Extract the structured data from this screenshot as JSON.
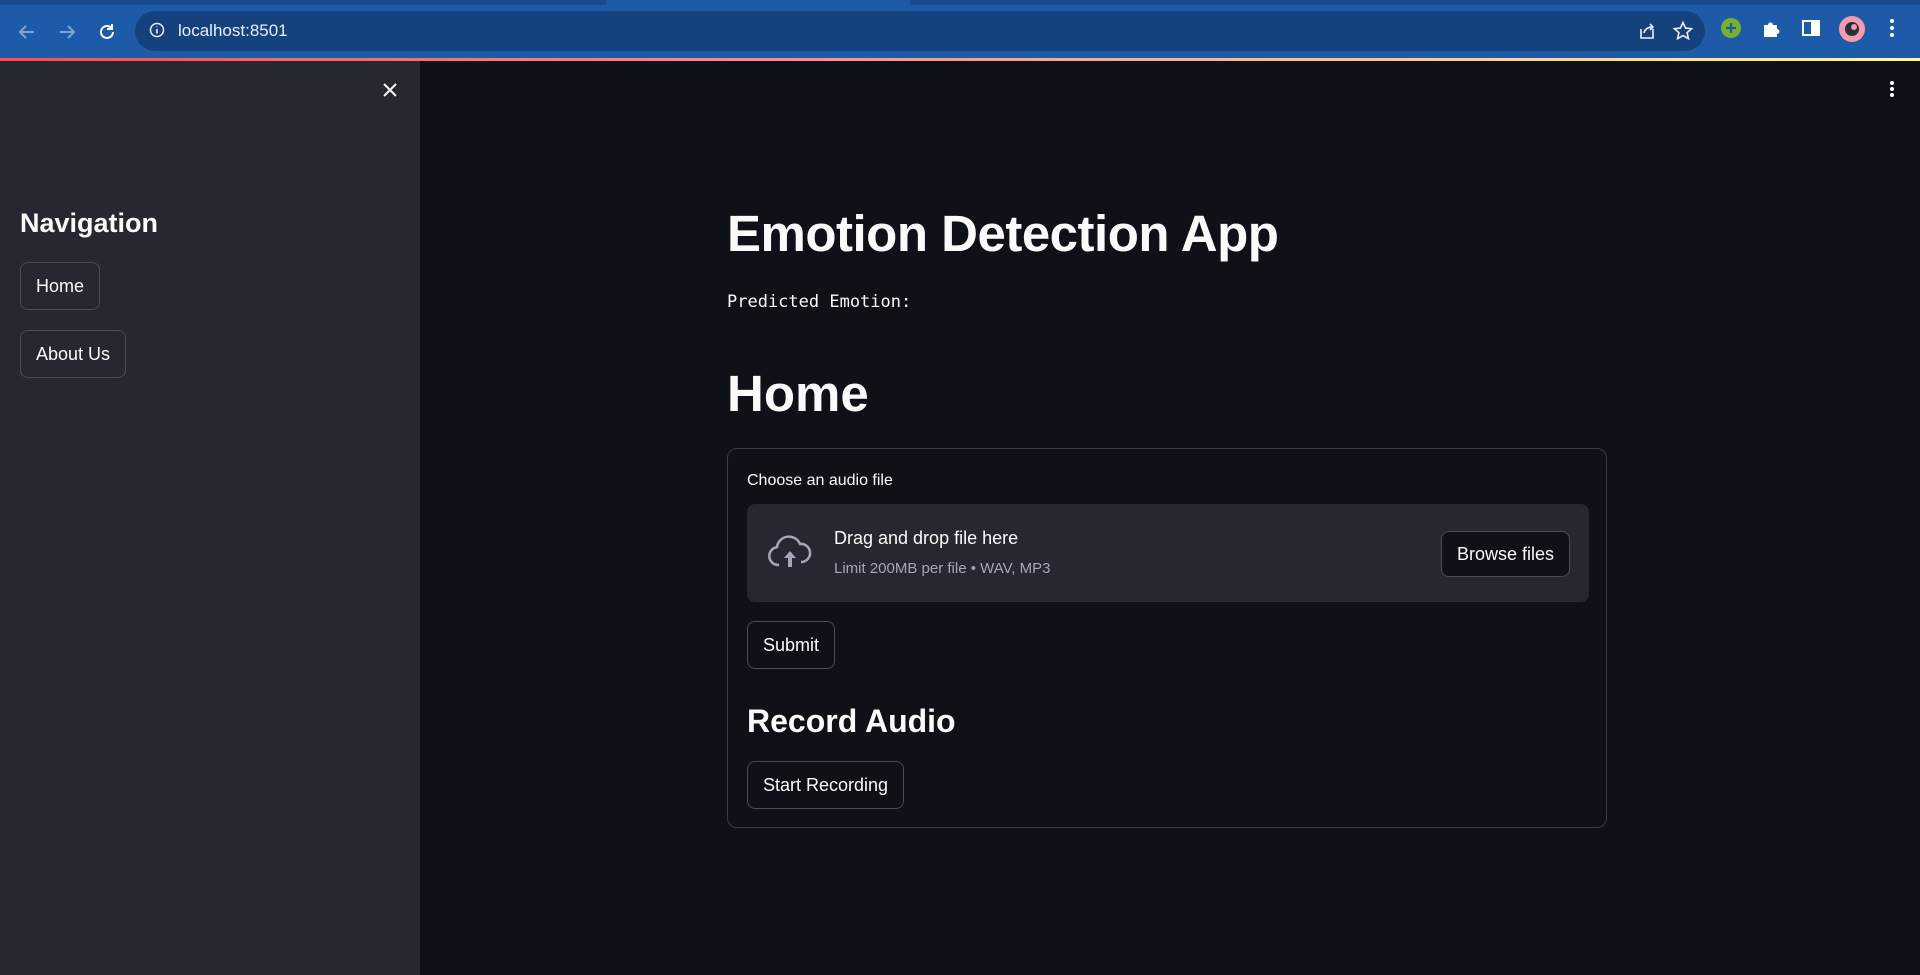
{
  "browser": {
    "url": "localhost:8501",
    "icons": [
      "back-arrow-icon",
      "forward-arrow-icon",
      "reload-icon",
      "info-icon",
      "share-icon",
      "star-icon",
      "extension-plus-icon",
      "puzzle-icon",
      "side-panel-icon",
      "avatar",
      "kebab-menu-icon"
    ]
  },
  "sidebar": {
    "heading": "Navigation",
    "items": [
      {
        "label": "Home"
      },
      {
        "label": "About Us"
      }
    ]
  },
  "main": {
    "title": "Emotion Detection App",
    "predicted_label": "Predicted Emotion:",
    "page_heading": "Home",
    "uploader": {
      "label": "Choose an audio file",
      "drop_text": "Drag and drop file here",
      "limit_text": "Limit 200MB per file • WAV, MP3",
      "browse_label": "Browse files"
    },
    "submit_label": "Submit",
    "record_heading": "Record Audio",
    "record_button_label": "Start Recording"
  },
  "colors": {
    "background": "#0e1117",
    "sidebar": "#262730",
    "chrome": "#1d5aa8",
    "accent": "#ff4b4b"
  }
}
